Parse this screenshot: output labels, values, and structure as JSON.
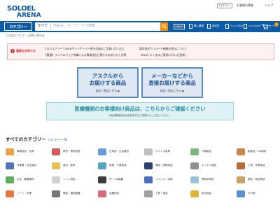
{
  "colors": {
    "brand_blue": "#0d5aa6",
    "accent_orange": "#f29100",
    "notice_red": "#d62f2f",
    "cyan_banner": "#dff2f5",
    "panel_bg": "#dde8f3"
  },
  "header": {
    "logo_top": "SOLOEL",
    "logo_bottom": "ARENA",
    "login_label": "ログイン",
    "customer_label": "お客様の情報",
    "help_label": "ヘルプ",
    "category_button": "カテゴリー",
    "search_scope": "すべて",
    "search_placeholder": "商品名、キーワードで検索",
    "detail_search": "詳細検索",
    "nav": [
      "購入履歴",
      "請求書",
      "クイック注文",
      "マイカタログ"
    ],
    "cart_label": "カート",
    "cart_count": "0",
    "breadcrumb": "ご注文について・お問い合わせ"
  },
  "notice": {
    "label": "重要なお知らせ",
    "items": [
      "ソロエルアリーナWEBサイトサーバー保守点検のご注意(7月11日)",
      "請求書ダウンロード機能の停止について",
      "【重要】ランサムウェア攻撃による情報流出に関するお知らせと対策",
      "【FAQ】よくあるご質問(7月11日更新)"
    ]
  },
  "delivery": {
    "left_title_1": "アスクルから",
    "left_title_2": "お届けする商品",
    "left_link": "商品一覧はこちら ▶",
    "right_title_1": "メーカーなどから",
    "right_title_2": "直接お届けする商品",
    "right_link": "商品一覧はこちら ▶"
  },
  "medical": {
    "title": "医療機関のお客様向け商品は、こちらからご確認ください",
    "note": "※医療関連商品は取扱条件をご確認の上ご注文ください。"
  },
  "categories": {
    "heading": "すべてのカテゴリー",
    "list_link": "カテゴリー一覧",
    "items": [
      "事務用品・文具",
      "電池・電気用品",
      "日用品・生活雑貨",
      "オフィス家具",
      "介護用品",
      "紙製品・OA用紙",
      "作業着・安全用品",
      "食品・飲料",
      "医療・介護用品",
      "掃除・清掃用品",
      "キッチン用品",
      "工具・作業用品",
      "生花・観葉植物",
      "トイレ用品",
      "PC・OA機器",
      "ファイル・収納",
      "理化学用品",
      "梱包・発送用品",
      "ノート・手帳",
      "電話・通信機器",
      "店舗用品",
      "工具・部品",
      "防災用品",
      "その他"
    ]
  }
}
